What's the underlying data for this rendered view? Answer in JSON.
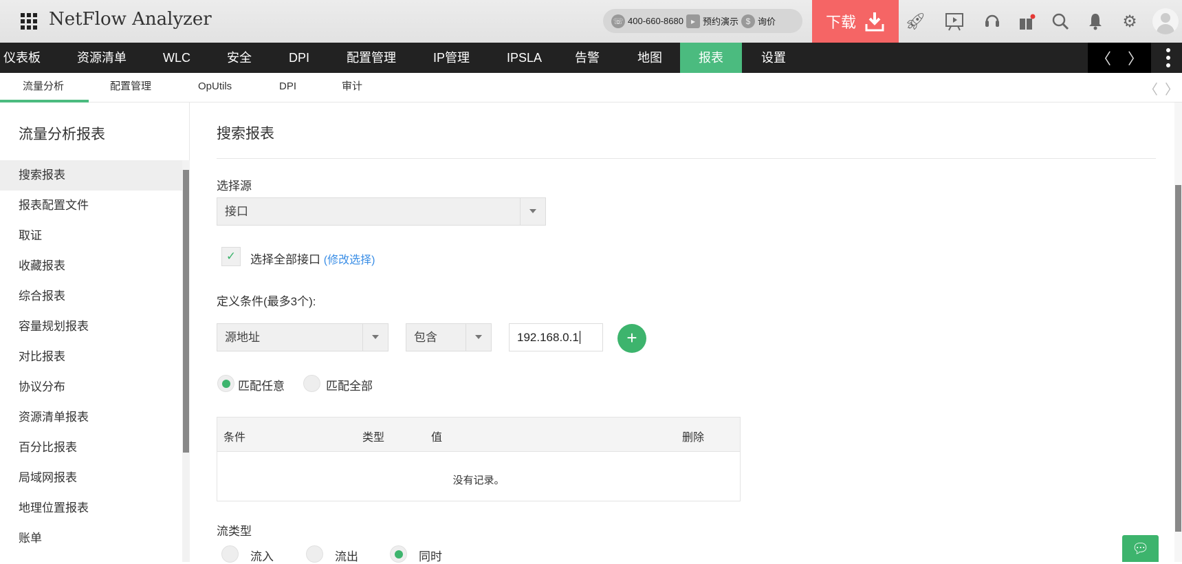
{
  "header": {
    "app_title": "NetFlow Analyzer",
    "phone": "400-660-8680",
    "demo": "预约演示",
    "price": "询价",
    "download": "下载"
  },
  "nav": {
    "items": [
      "仪表板",
      "资源清单",
      "WLC",
      "安全",
      "DPI",
      "配置管理",
      "IP管理",
      "IPSLA",
      "告警",
      "地图",
      "报表",
      "设置"
    ],
    "active": "报表"
  },
  "subnav": {
    "items": [
      "流量分析",
      "配置管理",
      "OpUtils",
      "DPI",
      "审计"
    ],
    "active": "流量分析"
  },
  "sidebar": {
    "title": "流量分析报表",
    "items": [
      "搜索报表",
      "报表配置文件",
      "取证",
      "收藏报表",
      "综合报表",
      "容量规划报表",
      "对比报表",
      "协议分布",
      "资源清单报表",
      "百分比报表",
      "局域网报表",
      "地理位置报表",
      "账单"
    ],
    "active": "搜索报表"
  },
  "main": {
    "title": "搜索报表",
    "source_label": "选择源",
    "source_value": "接口",
    "select_all_label": "选择全部接口",
    "modify_link": "(修改选择)",
    "criteria_label": "定义条件(最多3个):",
    "criteria_field": "源地址",
    "criteria_op": "包含",
    "criteria_value": "192.168.0.1",
    "match_any": "匹配任意",
    "match_all": "匹配全部",
    "table": {
      "columns": [
        "条件",
        "类型",
        "值",
        "删除"
      ],
      "empty": "没有记录。"
    },
    "flow_type_label": "流类型",
    "flow_types": [
      "流入",
      "流出",
      "同时"
    ],
    "flow_type_selected": "同时"
  },
  "colors": {
    "accent": "#4bbb7f",
    "download": "#f56565",
    "link": "#3a8ee6"
  }
}
